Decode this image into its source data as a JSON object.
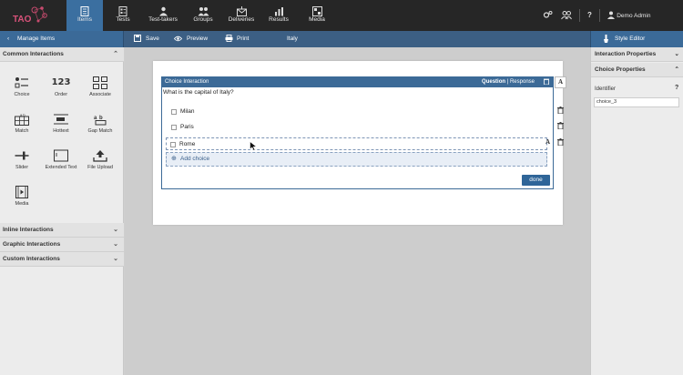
{
  "app": {
    "logo_text": "TAO",
    "nav": [
      {
        "label": "Items",
        "icon": "items-icon",
        "active": true
      },
      {
        "label": "Tests",
        "icon": "tests-icon"
      },
      {
        "label": "Test-takers",
        "icon": "test-takers-icon"
      },
      {
        "label": "Groups",
        "icon": "groups-icon"
      },
      {
        "label": "Deliveries",
        "icon": "deliveries-icon"
      },
      {
        "label": "Results",
        "icon": "results-icon"
      },
      {
        "label": "Media",
        "icon": "media-icon"
      }
    ],
    "help_label": "?",
    "user_name": "Demo Admin"
  },
  "toolbar": {
    "manage_items": "Manage Items",
    "save": "Save",
    "preview": "Preview",
    "print": "Print",
    "item_title": "Italy",
    "style_editor": "Style Editor"
  },
  "left_panel": {
    "common_title": "Common Interactions",
    "tools": [
      {
        "label": "Choice",
        "icon": "choice-icon"
      },
      {
        "label": "Order",
        "icon": "order-icon",
        "glyph": "123"
      },
      {
        "label": "Associate",
        "icon": "associate-icon"
      },
      {
        "label": "Match",
        "icon": "match-icon"
      },
      {
        "label": "Hottext",
        "icon": "hottext-icon"
      },
      {
        "label": "Gap Match",
        "icon": "gap-match-icon"
      },
      {
        "label": "Slider",
        "icon": "slider-icon"
      },
      {
        "label": "Extended Text",
        "icon": "extended-text-icon"
      },
      {
        "label": "File Upload",
        "icon": "file-upload-icon"
      },
      {
        "label": "Media",
        "icon": "media-tool-icon"
      }
    ],
    "sections": [
      "Inline Interactions",
      "Graphic Interactions",
      "Custom Interactions"
    ]
  },
  "editor": {
    "interaction_title": "Choice Interaction",
    "question_tab": "Question",
    "response_tab": "Response",
    "prompt": "What is the capital of Italy?",
    "choices": [
      "Milan",
      "Paris",
      "Rome"
    ],
    "add_choice": "Add choice",
    "done": "done",
    "format_glyph": "A"
  },
  "right_panel": {
    "interaction_properties": "Interaction Properties",
    "choice_properties": "Choice Properties",
    "identifier_label": "Identifier",
    "identifier_value": "choice_3",
    "help": "?"
  },
  "colors": {
    "topbar": "#262626",
    "accent": "#3b6fa0",
    "secondary_bar": "#3c5f84",
    "done_button": "#2f6598"
  }
}
